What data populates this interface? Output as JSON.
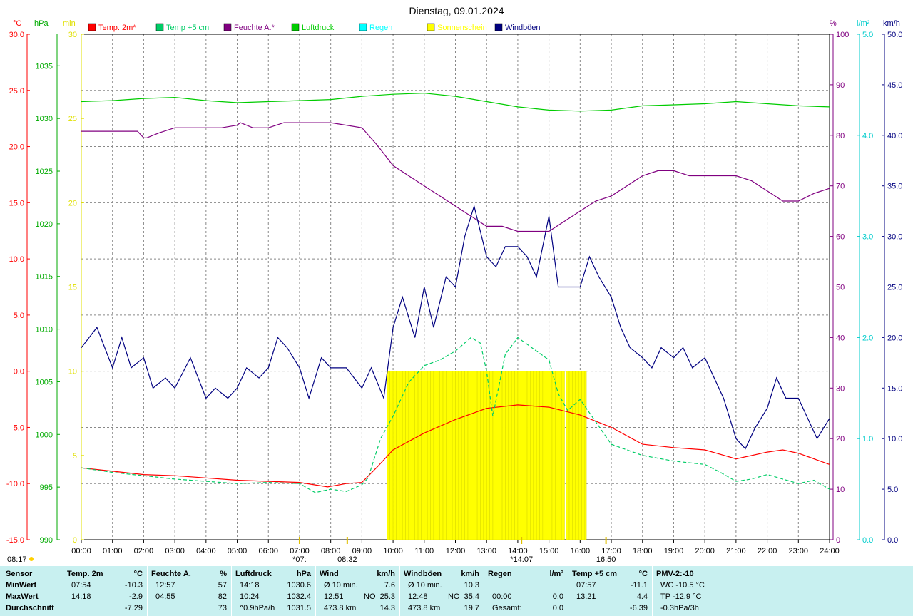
{
  "chart_data": {
    "type": "line",
    "title": "Dienstag, 09.01.2024",
    "legend_position": "top",
    "legend": [
      {
        "label": "Temp. 2m*",
        "color": "#ff0000"
      },
      {
        "label": "Temp +5 cm",
        "color": "#00cc66"
      },
      {
        "label": "Feuchte A.*",
        "color": "#800080"
      },
      {
        "label": "Luftdruck",
        "color": "#00cc00"
      },
      {
        "label": "Regen",
        "color": "#00ffff"
      },
      {
        "label": "Sonnenschein",
        "color": "#ffff00"
      },
      {
        "label": "Windböen",
        "color": "#000080"
      }
    ],
    "x_ticks": [
      "00:00",
      "01:00",
      "02:00",
      "03:00",
      "04:00",
      "05:00",
      "06:00",
      "07:00",
      "08:00",
      "09:00",
      "10:00",
      "11:00",
      "12:00",
      "13:00",
      "14:00",
      "15:00",
      "16:00",
      "17:00",
      "18:00",
      "19:00",
      "20:00",
      "21:00",
      "22:00",
      "23:00",
      "24:00"
    ],
    "axes": {
      "temp": {
        "unit": "°C",
        "color": "#ff0000",
        "range": [
          -15,
          30
        ],
        "ticks": [
          "30.0",
          "25.0",
          "20.0",
          "15.0",
          "10.0",
          "5.0",
          "0.0",
          "-5.0",
          "-10.0",
          "-15.0"
        ]
      },
      "pressure": {
        "unit": "hPa",
        "color": "#00aa00",
        "range": [
          990,
          1038
        ],
        "ticks": [
          "1035",
          "1030",
          "1025",
          "1020",
          "1015",
          "1010",
          "1005",
          "1000",
          "995",
          "990"
        ]
      },
      "sun_minutes": {
        "unit": "min",
        "color": "#e0e000",
        "range": [
          0,
          30
        ],
        "ticks": [
          "30",
          "25",
          "20",
          "15",
          "10",
          "5",
          "0"
        ]
      },
      "humidity": {
        "unit": "%",
        "color": "#800080",
        "range": [
          0,
          100
        ],
        "ticks": [
          "100",
          "90",
          "80",
          "70",
          "60",
          "50",
          "40",
          "30",
          "20",
          "10",
          "0"
        ]
      },
      "rain": {
        "unit": "l/m²",
        "color": "#00cccc",
        "range": [
          0,
          5
        ],
        "ticks": [
          "5.0",
          "4.0",
          "3.0",
          "2.0",
          "1.0",
          "0.0"
        ]
      },
      "wind": {
        "unit": "km/h",
        "color": "#000080",
        "range": [
          0,
          50
        ],
        "ticks": [
          "50.0",
          "45.0",
          "40.0",
          "35.0",
          "30.0",
          "25.0",
          "20.0",
          "15.0",
          "10.0",
          "5.0",
          "0.0"
        ]
      }
    },
    "series": [
      {
        "name": "Temp. 2m*",
        "axis": "temp",
        "color": "#ff0000",
        "x": [
          0,
          1,
          2,
          3,
          4,
          5,
          6,
          7,
          7.9,
          8.5,
          9,
          9.5,
          10,
          11,
          12,
          13,
          14,
          15,
          16,
          17,
          18,
          19,
          20,
          21,
          22,
          22.5,
          23,
          24
        ],
        "y": [
          -8.6,
          -8.9,
          -9.2,
          -9.3,
          -9.5,
          -9.7,
          -9.8,
          -9.9,
          -10.3,
          -10.0,
          -9.9,
          -8.5,
          -7.0,
          -5.5,
          -4.3,
          -3.3,
          -3.0,
          -3.2,
          -3.9,
          -5.0,
          -6.5,
          -6.8,
          -7.0,
          -7.8,
          -7.2,
          -7.0,
          -7.3,
          -8.3
        ]
      },
      {
        "name": "Temp +5 cm",
        "axis": "temp",
        "color": "#00cc66",
        "x": [
          0,
          1,
          2,
          3,
          4,
          5,
          6,
          7,
          7.5,
          8,
          8.5,
          9,
          9.2,
          9.6,
          10,
          10.5,
          11,
          11.5,
          12,
          12.5,
          12.8,
          13,
          13.2,
          13.6,
          14,
          14.5,
          15,
          15.3,
          15.6,
          16,
          16.5,
          17,
          18,
          19,
          20,
          20.5,
          21,
          21.5,
          22,
          22.5,
          23,
          23.5,
          24
        ],
        "y": [
          -8.6,
          -9.0,
          -9.3,
          -9.6,
          -9.8,
          -10.0,
          -9.9,
          -10.0,
          -10.8,
          -10.5,
          -10.7,
          -10.1,
          -9.5,
          -6.0,
          -4.0,
          -1.0,
          0.5,
          1.0,
          1.8,
          3.0,
          2.5,
          0.0,
          -4.0,
          1.5,
          3.0,
          2.0,
          1.0,
          -2.0,
          -3.5,
          -2.5,
          -4.5,
          -6.5,
          -7.5,
          -8.0,
          -8.3,
          -9.0,
          -9.8,
          -9.6,
          -9.2,
          -9.6,
          -10.0,
          -9.7,
          -10.5
        ]
      },
      {
        "name": "Feuchte A.*",
        "axis": "humidity",
        "color": "#800080",
        "x": [
          0,
          1,
          1.8,
          2.0,
          2.1,
          2.5,
          3,
          3.5,
          4,
          4.5,
          5,
          5.1,
          5.5,
          6,
          6.5,
          7,
          8,
          9,
          9.5,
          10,
          10.5,
          11,
          11.5,
          12,
          12.5,
          13,
          13.5,
          14,
          14.5,
          15,
          15.5,
          16,
          16.5,
          17,
          17.5,
          18,
          18.5,
          19,
          19.5,
          20,
          20.5,
          21,
          21.5,
          22,
          22.5,
          23,
          23.5,
          24
        ],
        "y": [
          80.8,
          80.8,
          80.8,
          79.5,
          79.5,
          80.5,
          81.5,
          81.5,
          81.5,
          81.5,
          82.0,
          82.5,
          81.5,
          81.5,
          82.5,
          82.5,
          82.5,
          81.5,
          78,
          74,
          72,
          70,
          68,
          66,
          64,
          62,
          62,
          61,
          61,
          61,
          63,
          65,
          67,
          68,
          70,
          72,
          73,
          73,
          72,
          72,
          72,
          72,
          71,
          69,
          67,
          67,
          68.5,
          69.5
        ]
      },
      {
        "name": "Luftdruck",
        "axis": "pressure",
        "color": "#00cc00",
        "x": [
          0,
          1,
          2,
          3,
          4,
          5,
          6,
          7,
          8,
          9,
          10,
          11,
          12,
          13,
          14,
          15,
          16,
          17,
          18,
          19,
          20,
          21,
          22,
          23,
          24
        ],
        "y": [
          1031.6,
          1031.7,
          1031.9,
          1032.0,
          1031.7,
          1031.5,
          1031.6,
          1031.7,
          1031.8,
          1032.1,
          1032.3,
          1032.4,
          1032.1,
          1031.6,
          1031.1,
          1030.8,
          1030.7,
          1030.8,
          1031.2,
          1031.3,
          1031.4,
          1031.6,
          1031.4,
          1031.2,
          1031.1
        ]
      },
      {
        "name": "Windböen",
        "axis": "wind",
        "color": "#000080",
        "x": [
          0,
          0.5,
          1,
          1.3,
          1.6,
          2,
          2.3,
          2.7,
          3,
          3.5,
          4,
          4.3,
          4.7,
          5,
          5.3,
          5.7,
          6,
          6.3,
          6.6,
          7,
          7.3,
          7.7,
          8,
          8.5,
          9,
          9.3,
          9.7,
          10,
          10.3,
          10.7,
          11,
          11.3,
          11.7,
          12,
          12.3,
          12.6,
          13,
          13.3,
          13.6,
          14,
          14.3,
          14.6,
          15,
          15.3,
          15.6,
          16,
          16.3,
          16.6,
          17,
          17.3,
          17.6,
          18,
          18.3,
          18.6,
          19,
          19.3,
          19.6,
          20,
          20.3,
          20.6,
          21,
          21.3,
          21.6,
          22,
          22.3,
          22.6,
          23,
          23.3,
          23.6,
          24
        ],
        "y": [
          19,
          21,
          17,
          20,
          17,
          18,
          15,
          16,
          15,
          18,
          14,
          15,
          14,
          15,
          17,
          16,
          17,
          20,
          19,
          17,
          14,
          18,
          17,
          17,
          15,
          17,
          14,
          21,
          24,
          20,
          25,
          21,
          26,
          25,
          30,
          33,
          28,
          27,
          29,
          29,
          28,
          26,
          32,
          25,
          25,
          25,
          28,
          26,
          24,
          21,
          19,
          18,
          17,
          19,
          18,
          19,
          17,
          18,
          16,
          14,
          10,
          9,
          11,
          13,
          16,
          14,
          14,
          12,
          10,
          12
        ]
      }
    ],
    "sunshine": [
      {
        "from": 9.8,
        "to": 15.5
      },
      {
        "from": 15.55,
        "to": 16.2
      }
    ],
    "sun_minutes_level": 10,
    "markers": [
      {
        "x": 7.0,
        "label": "*07:"
      },
      {
        "x": 8.53,
        "label": "08:32"
      },
      {
        "x": 14.12,
        "label": "*14:07"
      },
      {
        "x": 16.83,
        "label": "16:50"
      }
    ],
    "sunrise_label": "08:17"
  },
  "stats": {
    "sensor": {
      "header": "Sensor",
      "rows": [
        "MinWert",
        "MaxWert",
        "Durchschnitt"
      ]
    },
    "columns": [
      {
        "header": "Temp. 2m",
        "unit": "°C",
        "left": [
          "07:54",
          "14:18",
          ""
        ],
        "right": [
          "-10.3",
          "-2.9",
          "-7.29"
        ]
      },
      {
        "header": "Feuchte A.",
        "unit": "%",
        "left": [
          "12:57",
          "04:55",
          ""
        ],
        "right": [
          "57",
          "82",
          "73"
        ]
      },
      {
        "header": "Luftdruck",
        "unit": "hPa",
        "left": [
          "14:18",
          "10:24",
          "^0.9hPa/h"
        ],
        "right": [
          "1030.6",
          "1032.4",
          "1031.5"
        ]
      },
      {
        "header": "Wind",
        "unit": "km/h",
        "left": [
          "Ø 10 min.",
          "12:51",
          "473.8 km"
        ],
        "mid": [
          "",
          "NO",
          ""
        ],
        "right": [
          "7.6",
          "25.3",
          "14.3"
        ]
      },
      {
        "header": "Windböen",
        "unit": "km/h",
        "left": [
          "Ø 10 min.",
          "12:48",
          "473.8 km"
        ],
        "mid": [
          "",
          "NO",
          ""
        ],
        "right": [
          "10.3",
          "35.4",
          "19.7"
        ]
      },
      {
        "header": "Regen",
        "unit": "l/m²",
        "left": [
          "",
          "00:00",
          "Gesamt:"
        ],
        "right": [
          "",
          "0.0",
          "0.0"
        ]
      },
      {
        "header": "Temp +5 cm",
        "unit": "°C",
        "left": [
          "07:57",
          "13:21",
          ""
        ],
        "right": [
          "-11.1",
          "4.4",
          "-6.39"
        ]
      },
      {
        "header": "PMV-2:-10",
        "unit": "",
        "left": [
          "WC -10.5 °C",
          "TP -12.9 °C",
          "-0.3hPa/3h"
        ],
        "right": [
          "",
          "",
          ""
        ]
      }
    ]
  }
}
